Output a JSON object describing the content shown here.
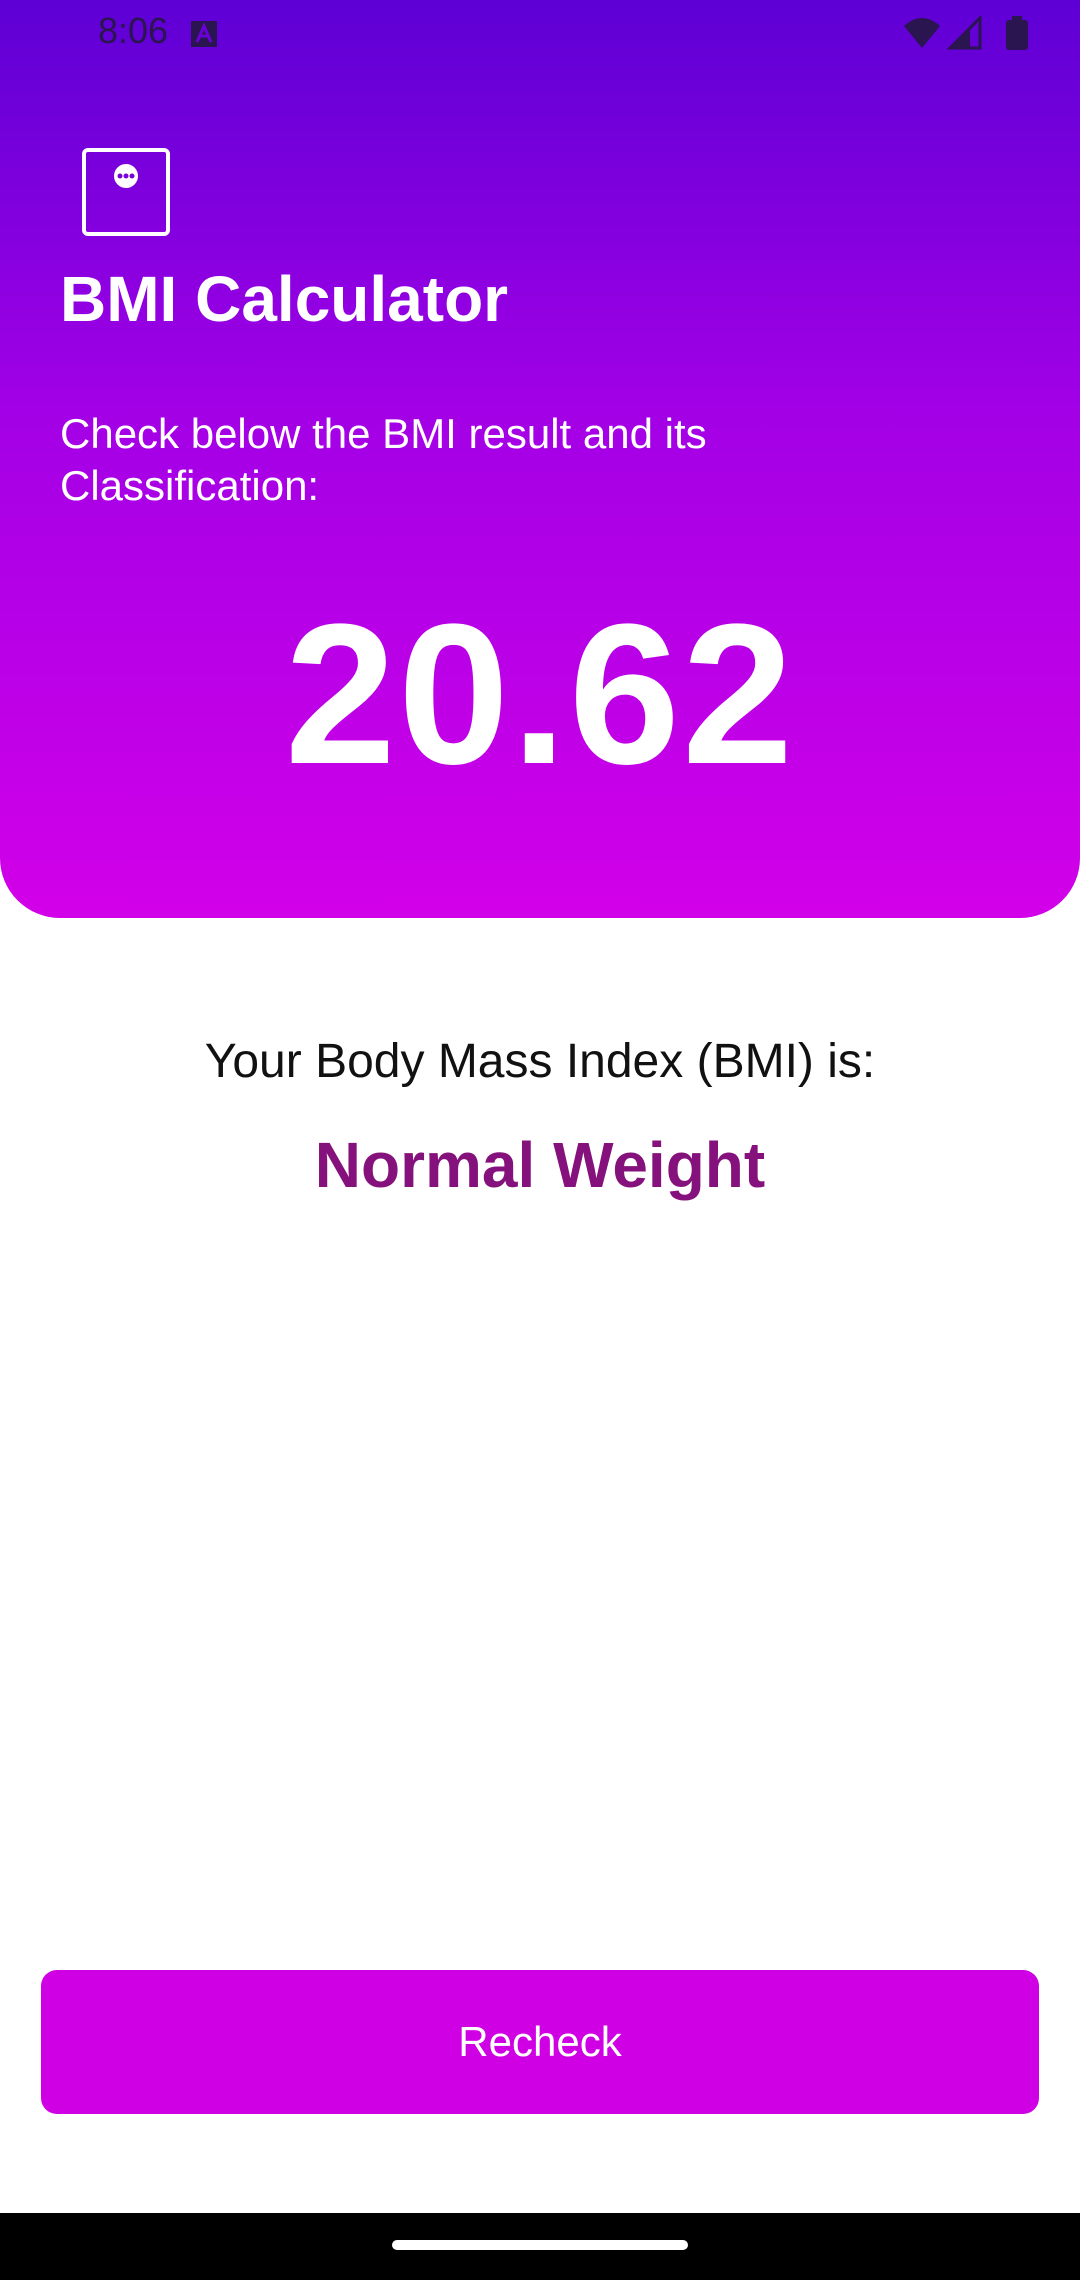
{
  "status_bar": {
    "time": "8:06",
    "icons": [
      "notification-a-icon",
      "wifi-icon",
      "cellular-signal-icon",
      "battery-icon"
    ]
  },
  "header": {
    "app_icon": "app-logo-icon",
    "title": "BMI Calculator",
    "subtitle": "Check below the BMI result and its Classification:",
    "bmi_value": "20.62"
  },
  "result": {
    "label": "Your Body Mass Index (BMI) is:",
    "classification": "Normal Weight"
  },
  "actions": {
    "recheck_label": "Recheck"
  },
  "colors": {
    "gradient_top": "#5d00d5",
    "gradient_bottom": "#d200e8",
    "button": "#d000e4",
    "classification_text": "#84117c"
  }
}
